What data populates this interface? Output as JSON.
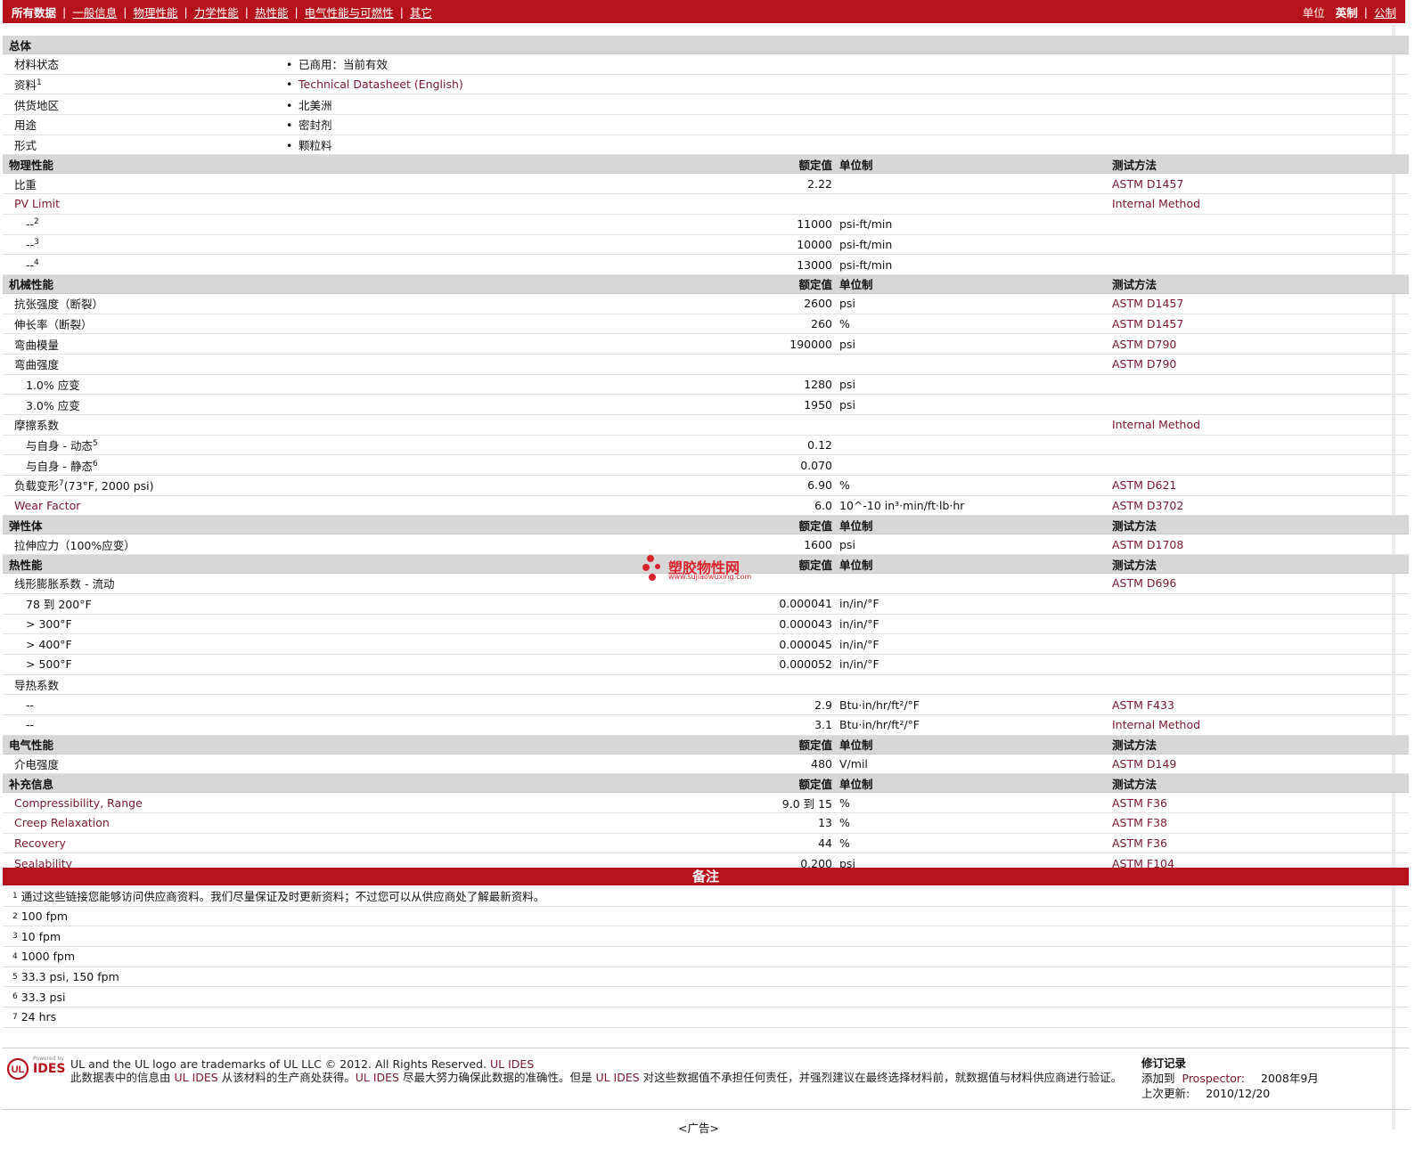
{
  "nav": {
    "all_data": "所有数据",
    "links": [
      "一般信息",
      "物理性能",
      "力学性能",
      "热性能",
      "电气性能与可燃性",
      "其它"
    ],
    "unit_label": "单位",
    "unit_imperial": "英制",
    "unit_metric": "公制"
  },
  "general": {
    "title": "总体",
    "rows": [
      {
        "label": "材料状态",
        "sup": "",
        "value": "已商用：当前有效",
        "link": false
      },
      {
        "label": "资料",
        "sup": "1",
        "value": "Technical Datasheet (English)",
        "link": true
      },
      {
        "label": "供货地区",
        "sup": "",
        "value": "北美洲",
        "link": false
      },
      {
        "label": "用途",
        "sup": "",
        "value": "密封剂",
        "link": false
      },
      {
        "label": "形式",
        "sup": "",
        "value": "颗粒料",
        "link": false
      }
    ]
  },
  "headers": {
    "rated": "额定值",
    "unit": "单位制",
    "method": "测试方法"
  },
  "sections": [
    {
      "title": "物理性能",
      "rows": [
        {
          "label": "比重",
          "sup": "",
          "sub": false,
          "value": "2.22",
          "unit": "",
          "method": "ASTM D1457",
          "link": false
        },
        {
          "label": "PV Limit",
          "sup": "",
          "sub": false,
          "value": "",
          "unit": "",
          "method": "Internal Method",
          "link": true
        },
        {
          "label": "--",
          "sup": "2",
          "sub": true,
          "value": "11000",
          "unit": "psi-ft/min",
          "method": "",
          "link": false
        },
        {
          "label": "--",
          "sup": "3",
          "sub": true,
          "value": "10000",
          "unit": "psi-ft/min",
          "method": "",
          "link": false
        },
        {
          "label": "--",
          "sup": "4",
          "sub": true,
          "value": "13000",
          "unit": "psi-ft/min",
          "method": "",
          "link": false
        }
      ]
    },
    {
      "title": "机械性能",
      "rows": [
        {
          "label": "抗张强度（断裂）",
          "sup": "",
          "sub": false,
          "value": "2600",
          "unit": "psi",
          "method": "ASTM D1457",
          "link": false
        },
        {
          "label": "伸长率（断裂）",
          "sup": "",
          "sub": false,
          "value": "260",
          "unit": "%",
          "method": "ASTM D1457",
          "link": false
        },
        {
          "label": "弯曲模量",
          "sup": "",
          "sub": false,
          "value": "190000",
          "unit": "psi",
          "method": "ASTM D790",
          "link": false
        },
        {
          "label": "弯曲强度",
          "sup": "",
          "sub": false,
          "value": "",
          "unit": "",
          "method": "ASTM D790",
          "link": false
        },
        {
          "label": "1.0% 应变",
          "sup": "",
          "sub": true,
          "value": "1280",
          "unit": "psi",
          "method": "",
          "link": false
        },
        {
          "label": "3.0% 应变",
          "sup": "",
          "sub": true,
          "value": "1950",
          "unit": "psi",
          "method": "",
          "link": false
        },
        {
          "label": "摩擦系数",
          "sup": "",
          "sub": false,
          "value": "",
          "unit": "",
          "method": "Internal Method",
          "link": false
        },
        {
          "label": "与自身 - 动态",
          "sup": "5",
          "sub": true,
          "value": "0.12",
          "unit": "",
          "method": "",
          "link": false
        },
        {
          "label": "与自身 - 静态",
          "sup": "6",
          "sub": true,
          "value": "0.070",
          "unit": "",
          "method": "",
          "link": false
        },
        {
          "label": "负载变形",
          "sup": "7",
          "extra": "(73°F, 2000 psi)",
          "sub": false,
          "value": "6.90",
          "unit": "%",
          "method": "ASTM D621",
          "link": false
        },
        {
          "label": "Wear Factor",
          "sup": "",
          "sub": false,
          "value": "6.0",
          "unit": "10^-10 in³·min/ft·lb·hr",
          "method": "ASTM D3702",
          "link": true
        }
      ]
    },
    {
      "title": "弹性体",
      "rows": [
        {
          "label": "拉伸应力（100%应变）",
          "sup": "",
          "sub": false,
          "value": "1600",
          "unit": "psi",
          "method": "ASTM D1708",
          "link": false
        }
      ]
    },
    {
      "title": "热性能",
      "rows": [
        {
          "label": "线形膨胀系数 - 流动",
          "sup": "",
          "sub": false,
          "value": "",
          "unit": "",
          "method": "ASTM D696",
          "link": false
        },
        {
          "label": "78 到 200°F",
          "sup": "",
          "sub": true,
          "value": "0.000041",
          "unit": "in/in/°F",
          "method": "",
          "link": false
        },
        {
          "label": "> 300°F",
          "sup": "",
          "sub": true,
          "value": "0.000043",
          "unit": "in/in/°F",
          "method": "",
          "link": false
        },
        {
          "label": "> 400°F",
          "sup": "",
          "sub": true,
          "value": "0.000045",
          "unit": "in/in/°F",
          "method": "",
          "link": false
        },
        {
          "label": "> 500°F",
          "sup": "",
          "sub": true,
          "value": "0.000052",
          "unit": "in/in/°F",
          "method": "",
          "link": false
        },
        {
          "label": "导热系数",
          "sup": "",
          "sub": false,
          "value": "",
          "unit": "",
          "method": "",
          "link": false
        },
        {
          "label": "--",
          "sup": "",
          "sub": true,
          "value": "2.9",
          "unit": "Btu·in/hr/ft²/°F",
          "method": "ASTM F433",
          "link": false
        },
        {
          "label": "--",
          "sup": "",
          "sub": true,
          "value": "3.1",
          "unit": "Btu·in/hr/ft²/°F",
          "method": "Internal Method",
          "link": false
        }
      ]
    },
    {
      "title": "电气性能",
      "rows": [
        {
          "label": "介电强度",
          "sup": "",
          "sub": false,
          "value": "480",
          "unit": "V/mil",
          "method": "ASTM D149",
          "link": false
        }
      ]
    },
    {
      "title": "补充信息",
      "rows": [
        {
          "label": "Compressibility, Range",
          "sup": "",
          "sub": false,
          "value": "9.0 到 15",
          "unit": "%",
          "method": "ASTM F36",
          "link": true
        },
        {
          "label": "Creep Relaxation",
          "sup": "",
          "sub": false,
          "value": "13",
          "unit": "%",
          "method": "ASTM F38",
          "link": true
        },
        {
          "label": "Recovery",
          "sup": "",
          "sub": false,
          "value": "44",
          "unit": "%",
          "method": "ASTM F36",
          "link": true
        },
        {
          "label": "Sealability",
          "sup": "",
          "sub": false,
          "value": "0.200",
          "unit": "psi",
          "method": "ASTM F104",
          "link": true
        }
      ]
    }
  ],
  "notes": {
    "title": "备注",
    "items": [
      {
        "num": "1",
        "text": "通过这些链接您能够访问供应商资料。我们尽量保证及时更新资料；不过您可以从供应商处了解最新资料。"
      },
      {
        "num": "2",
        "text": "100 fpm"
      },
      {
        "num": "3",
        "text": "10 fpm"
      },
      {
        "num": "4",
        "text": "1000 fpm"
      },
      {
        "num": "5",
        "text": "33.3 psi, 150 fpm"
      },
      {
        "num": "6",
        "text": "33.3 psi"
      },
      {
        "num": "7",
        "text": "24 hrs"
      }
    ]
  },
  "footer": {
    "logo_small": "Powered by",
    "logo_text": "IDES",
    "line1": "UL and the UL logo are trademarks of UL LLC © 2012. All Rights Reserved.",
    "line1_link": "UL IDES",
    "line2_a": "此数据表中的信息由",
    "line2_link1": "UL IDES",
    "line2_b": "从该材料的生产商处获得。",
    "line2_link2": "UL IDES",
    "line2_c": "尽最大努力确保此数据的准确性。但是",
    "line2_link3": "UL IDES",
    "line2_d": "对这些数据值不承担任何责任，并强烈建议在最终选择材料前，就数据值与材料供应商进行验证。",
    "rev_title": "修订记录",
    "rev_added_label": "添加到",
    "rev_added_link": "Prospector:",
    "rev_added_date": "2008年9月",
    "rev_updated_label": "上次更新:",
    "rev_updated_date": "2010/12/20"
  },
  "ad": "<广告>",
  "watermark": {
    "text": "塑胶物性网",
    "url": "www.sujiaowuxing.com"
  },
  "colors": {
    "brand_red": "#b5121b",
    "link_maroon": "#7a1630",
    "section_gray": "#d7d7d7"
  }
}
